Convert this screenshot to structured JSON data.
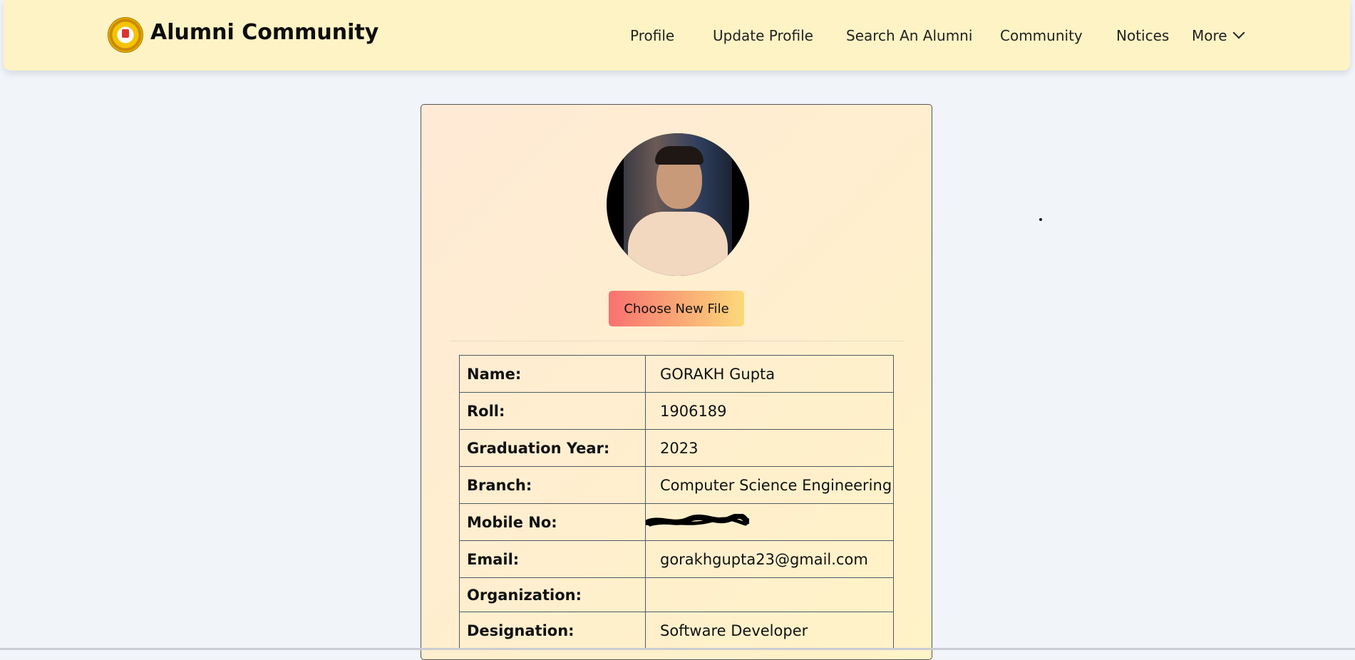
{
  "header": {
    "brand_title": "Alumni Community",
    "logo_icon": "college-seal-logo",
    "bg_color": "#fef3c5"
  },
  "nav": {
    "items": [
      "Profile",
      "Update Profile",
      "Search An Alumni",
      "Community",
      "Notices"
    ],
    "more_label": "More"
  },
  "profile": {
    "choose_file_label": "Choose New File",
    "fields": [
      {
        "label": "Name:",
        "value": "GORAKH Gupta"
      },
      {
        "label": "Roll:",
        "value": "1906189"
      },
      {
        "label": "Graduation Year:",
        "value": "2023"
      },
      {
        "label": "Branch:",
        "value": "Computer Science Engineering"
      },
      {
        "label": "Mobile No:",
        "value": ""
      },
      {
        "label": "Email:",
        "value": "gorakhgupta23@gmail.com"
      },
      {
        "label": "Organization:",
        "value": ""
      },
      {
        "label": "Designation:",
        "value": "Software Developer"
      }
    ]
  },
  "colors": {
    "page_bg": "#f1f5fa",
    "button_gradient_start": "#f87171",
    "button_gradient_end": "#fcd97a"
  }
}
